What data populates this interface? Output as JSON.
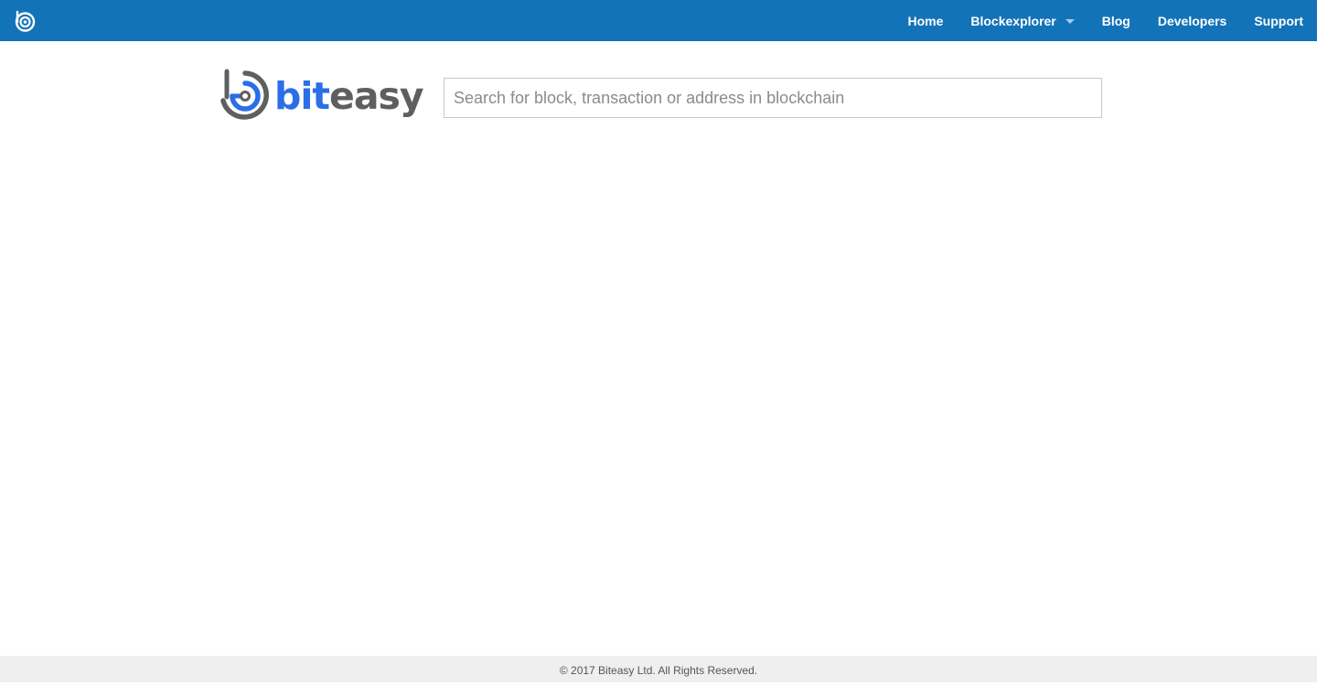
{
  "topbar": {
    "logo_icon": "biteasy-logo-icon",
    "nav": {
      "home": "Home",
      "blockexplorer": "Blockexplorer",
      "blog": "Blog",
      "developers": "Developers",
      "support": "Support"
    },
    "color": "#1373b8"
  },
  "brand": {
    "text_bit": "bit",
    "text_easy": "easy",
    "colors": {
      "bit": "#2a6ee8",
      "easy": "#5e5f61"
    }
  },
  "search": {
    "placeholder": "Search for block, transaction or address in blockchain",
    "value": ""
  },
  "footer": {
    "copyright": "© 2017 Biteasy Ltd. All Rights Reserved."
  }
}
